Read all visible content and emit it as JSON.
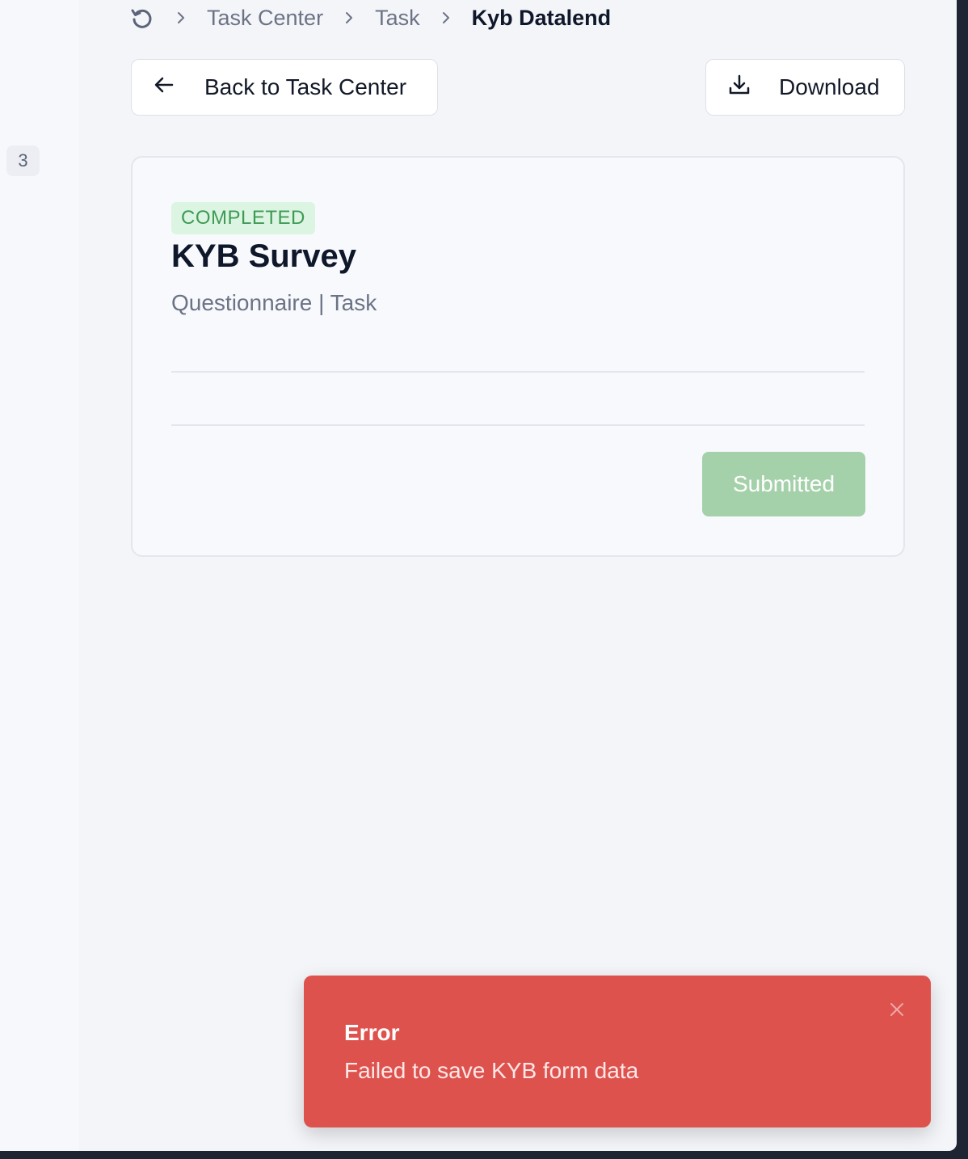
{
  "breadcrumb": {
    "items": [
      "Task Center",
      "Task"
    ],
    "current": "Kyb Datalend"
  },
  "actions": {
    "back_label": "Back to Task Center",
    "download_label": "Download"
  },
  "sidebar": {
    "badge": "3"
  },
  "card": {
    "status": "COMPLETED",
    "title": "KYB Survey",
    "subtitle": "Questionnaire | Task",
    "submit_label": "Submitted"
  },
  "toast": {
    "title": "Error",
    "message": "Failed to save KYB form data"
  },
  "colors": {
    "accent_success": "#3f9a55",
    "success_bg": "#dcf5e2",
    "button_disabled": "#a4d1a9",
    "error": "#de524e"
  }
}
